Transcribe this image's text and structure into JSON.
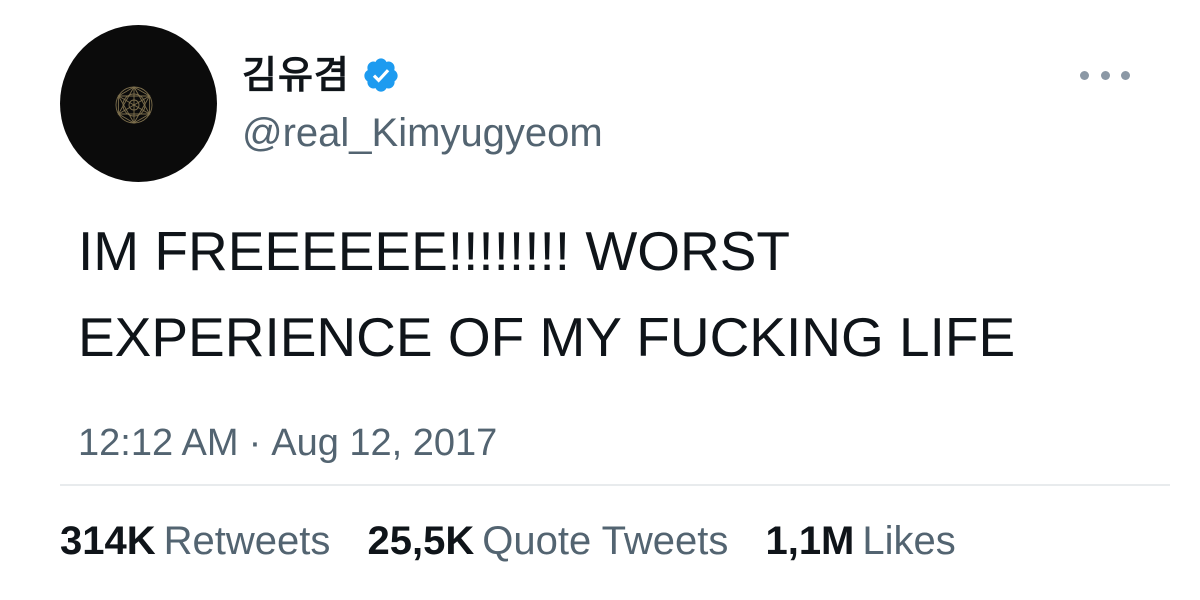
{
  "author": {
    "display_name": "김유겸",
    "handle": "@real_Kimyugyeom",
    "avatar_icon": "geometric-mandala-avatar",
    "verified_icon": "verified-badge-icon",
    "verified_color": "#1d9bf0"
  },
  "tweet": {
    "text": "IM FREEEEEE!!!!!!!! WORST\nEXPERIENCE OF MY FUCKING LIFE",
    "time": "12:12 AM",
    "separator": "·",
    "date": "Aug 12, 2017"
  },
  "menu": {
    "icon": "more-options-icon"
  },
  "stats": {
    "retweets": {
      "count": "314K",
      "label": "Retweets"
    },
    "quote_tweets": {
      "count": "25,5K",
      "label": "Quote Tweets"
    },
    "likes": {
      "count": "1,1M",
      "label": "Likes"
    }
  },
  "colors": {
    "text_primary": "#0f1419",
    "text_secondary": "#536471",
    "divider": "#e8ebed",
    "avatar_background": "#0b0b0b"
  }
}
